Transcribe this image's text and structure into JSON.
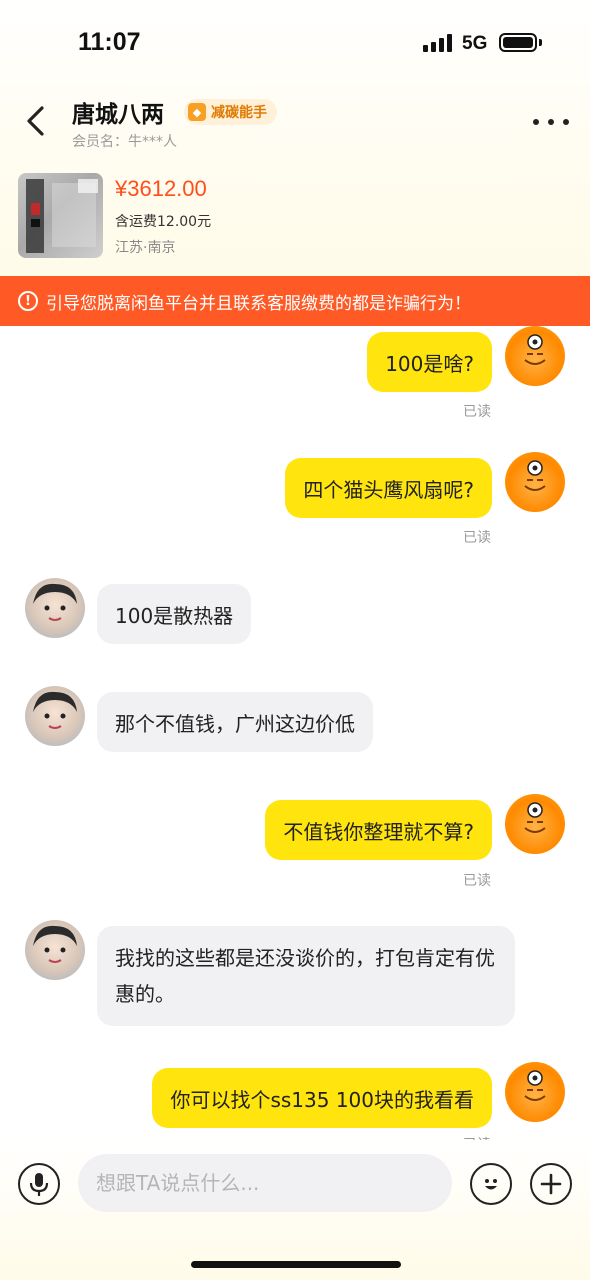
{
  "status_bar": {
    "time": "11:07",
    "network": "5G"
  },
  "header": {
    "seller_name": "唐城八两",
    "badge_label": "减碳能手",
    "member_line": "会员名：牛***人"
  },
  "product": {
    "price": "¥3612.00",
    "shipping": "含运费12.00元",
    "location": "江苏·南京"
  },
  "warning": {
    "text": "引导您脱离闲鱼平台并且联系客服缴费的都是诈骗行为！"
  },
  "messages": [
    {
      "from": "me",
      "text": "100是啥?",
      "status": "已读"
    },
    {
      "from": "me",
      "text": "四个猫头鹰风扇呢?",
      "status": "已读"
    },
    {
      "from": "other",
      "text": "100是散热器"
    },
    {
      "from": "other",
      "text": "那个不值钱，广州这边价低"
    },
    {
      "from": "me",
      "text": "不值钱你整理就不算?",
      "status": "已读"
    },
    {
      "from": "other",
      "text": "我找的这些都是还没谈价的，打包肯定有优惠的。"
    },
    {
      "from": "me",
      "text": "你可以找个ss135 100块的我看看",
      "status": "已读"
    }
  ],
  "input": {
    "placeholder": "想跟TA说点什么..."
  },
  "colors": {
    "my_bubble": "#ffe50d",
    "other_bubble": "#f1f1f3",
    "warning_bg": "#ff5a26",
    "price": "#ff4e1a"
  },
  "icons": [
    "back-icon",
    "more-icon",
    "warning-icon",
    "microphone-icon",
    "emoji-icon",
    "plus-icon"
  ]
}
